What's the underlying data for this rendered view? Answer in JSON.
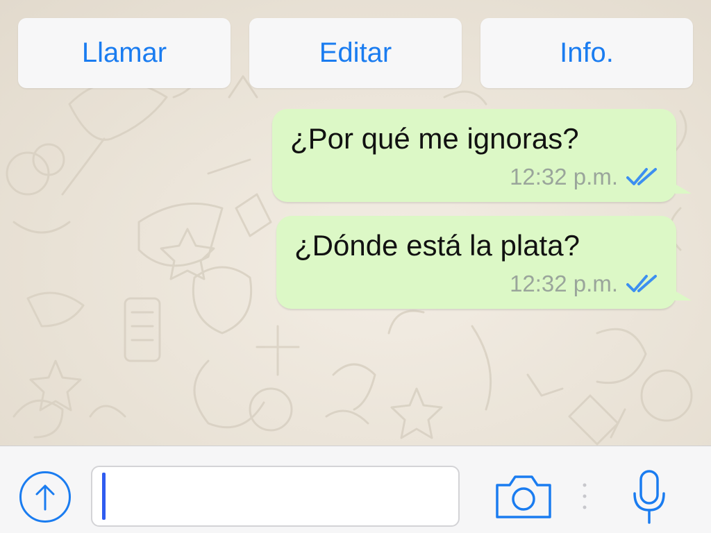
{
  "actions": {
    "call_label": "Llamar",
    "edit_label": "Editar",
    "info_label": "Info."
  },
  "messages": [
    {
      "text": "¿Por qué me ignoras?",
      "time": "12:32 p.m.",
      "status": "read"
    },
    {
      "text": "¿Dónde está la plata?",
      "time": "12:32 p.m.",
      "status": "read"
    }
  ],
  "composer": {
    "value": "",
    "attach_icon": "arrow-up-circle-icon",
    "camera_icon": "camera-icon",
    "mic_icon": "microphone-icon"
  },
  "colors": {
    "accent": "#1a7cf0",
    "outgoing_bubble": "#dcf8c6",
    "read_check": "#3c8ff0"
  }
}
